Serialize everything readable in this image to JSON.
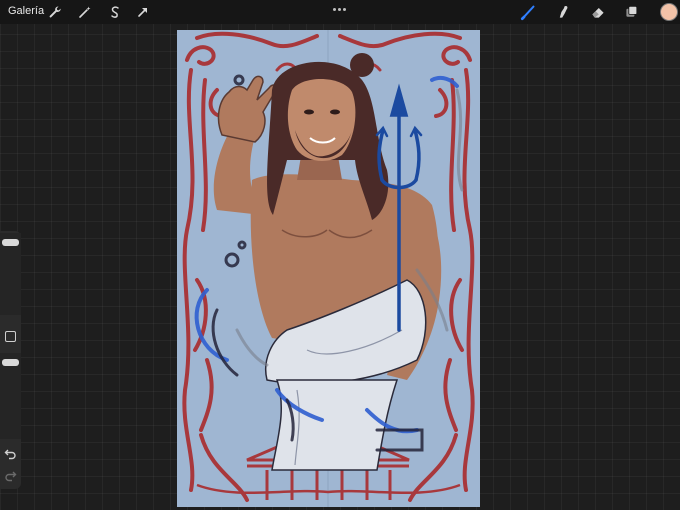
{
  "topbar": {
    "gallery_label": "Galería",
    "left_tools": [
      "wrench-icon",
      "magic-wand-icon",
      "selection-icon",
      "transform-arrow-icon"
    ],
    "right_tools": [
      "brush-icon",
      "smudge-icon",
      "eraser-icon",
      "layers-icon"
    ],
    "active_tool": "brush",
    "current_color": "#f2c2a8"
  },
  "sidebar": {
    "brush_size_level": 0.08,
    "opacity_level": 0.08
  },
  "canvas": {
    "background": "#9fb6d2",
    "frame_color": "#a8383c",
    "trident_color": "#1b4aa0"
  }
}
